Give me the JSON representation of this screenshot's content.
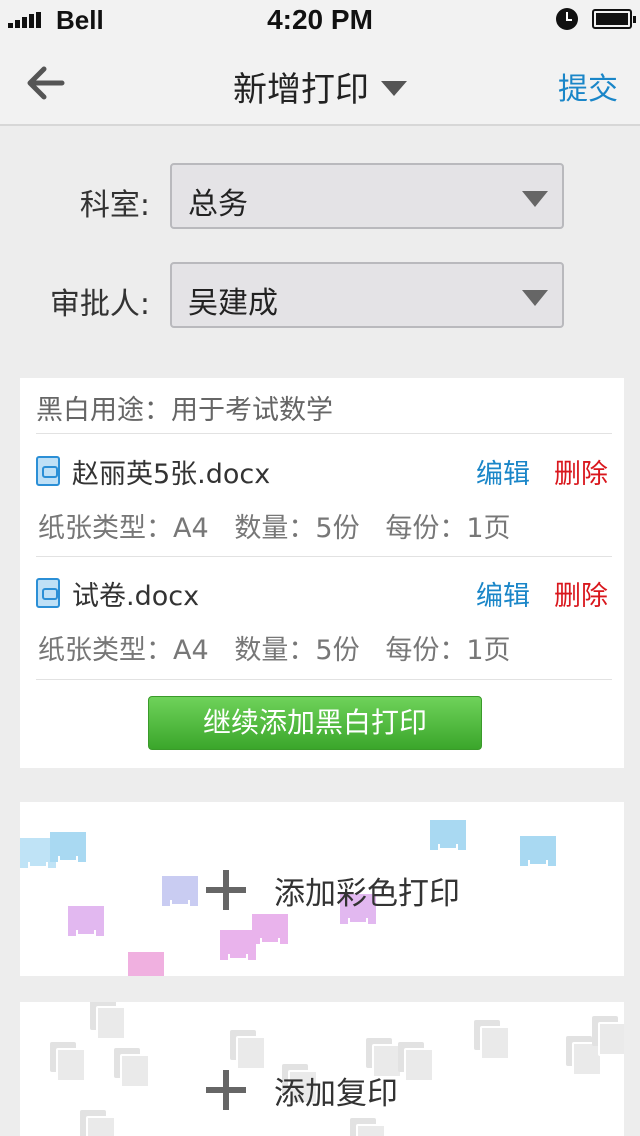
{
  "status_bar": {
    "carrier": "Bell",
    "time": "4:20 PM"
  },
  "nav": {
    "title": "新增打印",
    "submit": "提交",
    "back_icon": "arrow-left-icon"
  },
  "form": {
    "department": {
      "label": "科室:",
      "value": "总务"
    },
    "approver": {
      "label": "审批人:",
      "value": "吴建成"
    }
  },
  "bw_print": {
    "usage": "黑白用途：用于考试数学",
    "files": [
      {
        "name": "赵丽英5张.docx",
        "edit": "编辑",
        "delete": "删除",
        "meta": "纸张类型：A4   数量：5份   每份：1页"
      },
      {
        "name": "试卷.docx",
        "edit": "编辑",
        "delete": "删除",
        "meta": "纸张类型：A4   数量：5份   每份：1页"
      }
    ],
    "add_button": "继续添加黑白打印"
  },
  "color_print": {
    "label": "添加彩色打印",
    "icon": "plus-icon"
  },
  "copy": {
    "label": "添加复印",
    "icon": "plus-icon"
  },
  "colors": {
    "link": "#1a86c8",
    "danger": "#d9171d",
    "primary": "#3ba62b"
  }
}
